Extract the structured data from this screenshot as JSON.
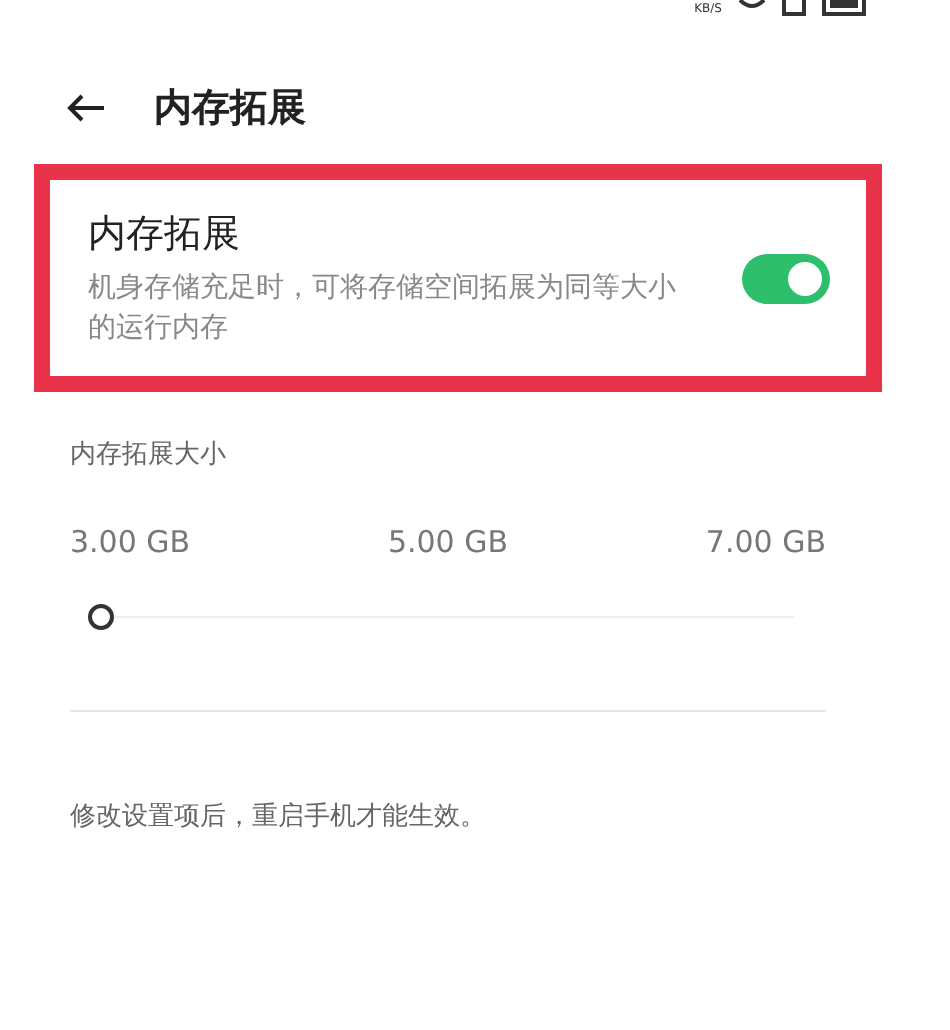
{
  "status_bar": {
    "speed_unit": "KB/S"
  },
  "header": {
    "title": "内存拓展"
  },
  "setting": {
    "title": "内存拓展",
    "description": "机身存储充足时，可将存储空间拓展为同等大小的运行内存",
    "on": true,
    "highlighted": true
  },
  "size_section": {
    "label": "内存拓展大小",
    "options": [
      "3.00 GB",
      "5.00 GB",
      "7.00 GB"
    ],
    "level": 0
  },
  "note": "修改设置项后，重启手机才能生效。"
}
